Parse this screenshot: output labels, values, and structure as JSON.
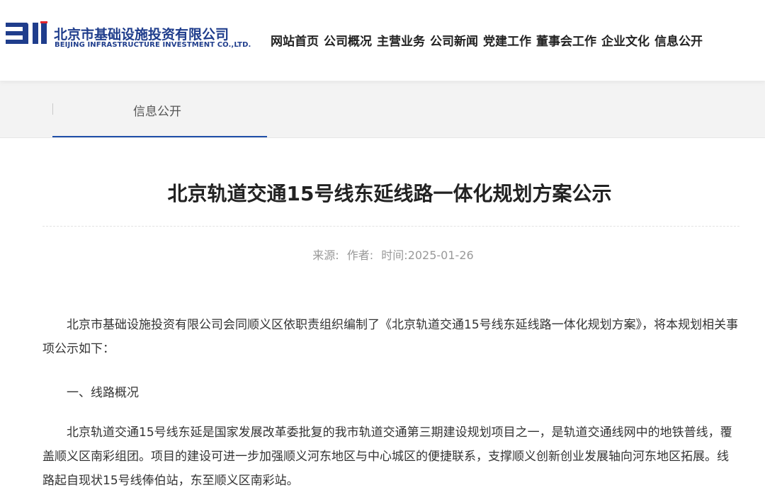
{
  "header": {
    "logo_text": "BII",
    "company_cn": "北京市基础设施投资有限公司",
    "company_en": "BEIJING INFRASTRUCTURE INVESTMENT CO.,LTD.",
    "brand_color": "#1f3d8c",
    "nav": [
      "网站首页",
      "公司概况",
      "主营业务",
      "公司新闻",
      "党建工作",
      "董事会工作",
      "企业文化",
      "信息公开"
    ]
  },
  "subnav": {
    "current": "信息公开",
    "accent_color": "#1f4fa8"
  },
  "article": {
    "title": "北京轨道交通15号线东延线路一体化规划方案公示",
    "meta": {
      "source": "来源:",
      "author": "作者:",
      "time": "时间:2025-01-26"
    },
    "paragraphs": [
      "北京市基础设施投资有限公司会同顺义区依职责组织编制了《北京轨道交通15号线东延线路一体化规划方案》，将本规划相关事项公示如下：",
      "一、线路概况",
      "北京轨道交通15号线东延是国家发展改革委批复的我市轨道交通第三期建设规划项目之一，是轨道交通线网中的地铁普线，覆盖顺义区南彩组团。项目的建设可进一步加强顺义河东地区与中心城区的便捷联系，支撑顺义创新创业发展轴向河东地区拓展。线路起自现状15号线俸伯站，东至顺义区南彩站。"
    ]
  }
}
